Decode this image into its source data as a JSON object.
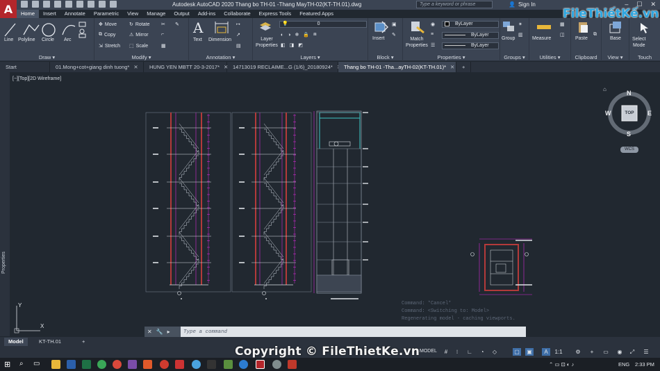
{
  "app": {
    "logo": "A",
    "title": "Autodesk AutoCAD 2020    Thang bo TH-01 -Thang  MayTH-02(KT-TH.01).dwg",
    "search_placeholder": "Type a keyword or phrase",
    "sign_in": "Sign In"
  },
  "ribbon_tabs": [
    "Home",
    "Insert",
    "Annotate",
    "Parametric",
    "View",
    "Manage",
    "Output",
    "Add-ins",
    "Collaborate",
    "Express Tools",
    "Featured Apps"
  ],
  "panels": {
    "draw": {
      "title": "Draw ▾",
      "line": "Line",
      "polyline": "Polyline",
      "circle": "Circle",
      "arc": "Arc"
    },
    "modify": {
      "title": "Modify ▾",
      "move": "Move",
      "copy": "Copy",
      "stretch": "Stretch",
      "rotate": "Rotate",
      "mirror": "Mirror",
      "scale": "Scale"
    },
    "annotation": {
      "title": "Annotation ▾",
      "text": "Text",
      "dimension": "Dimension"
    },
    "layers": {
      "title": "Layers ▾",
      "layer_properties": "Layer\nProperties",
      "current_layer": "0"
    },
    "block": {
      "title": "Block ▾",
      "insert": "Insert"
    },
    "properties": {
      "title": "Properties ▾",
      "match": "Match\nProperties",
      "color": "ByLayer",
      "linetype": "ByLayer",
      "lineweight": "ByLayer"
    },
    "groups": {
      "title": "Groups ▾",
      "group": "Group"
    },
    "utilities": {
      "title": "Utilities ▾",
      "measure": "Measure"
    },
    "clipboard": {
      "title": "Clipboard",
      "paste": "Paste"
    },
    "view": {
      "title": "View ▾",
      "base": "Base"
    },
    "touch": {
      "title": "Touch",
      "select_mode": "Select\nMode"
    }
  },
  "doc_tabs": [
    {
      "label": "Start",
      "active": false,
      "closable": false
    },
    {
      "label": "01.Mong+cot+giang dinh tuong*",
      "active": false,
      "closable": true
    },
    {
      "label": "HUNG YEN MBTT 20-3-2017*",
      "active": false,
      "closable": true
    },
    {
      "label": "14713019 RECLAIME...G (1/6)_20180924*",
      "active": false,
      "closable": true
    },
    {
      "label": "Thang bo TH-01 -Tha...ayTH-02(KT-TH.01)*",
      "active": true,
      "closable": true
    }
  ],
  "viewport_label": "[−][Top][2D Wireframe]",
  "properties_label": "Properties",
  "viewcube": {
    "top": "TOP",
    "n": "N",
    "s": "S",
    "e": "E",
    "w": "W",
    "wcs": "WCS"
  },
  "command_history": [
    "Command: *Cancel*",
    "Command:  <Switching to: Model>",
    "Regenerating model - caching viewports."
  ],
  "command_prompt": "Type a command",
  "layout_tabs": [
    {
      "label": "Model",
      "active": true
    },
    {
      "label": "KT-TH.01",
      "active": false
    }
  ],
  "status": {
    "model": "MODEL",
    "scale": "1:1"
  },
  "watermark": "Copyright © FileThietKe.vn",
  "brand": "FileThiếtKế.vn",
  "taskbar": {
    "lang": "ENG",
    "time": "2:33 PM"
  },
  "colors": {
    "accent": "#3f6fa8",
    "magenta": "#d62ad6",
    "red_wall": "#b33a3a",
    "cyan": "#3fc6c6"
  }
}
